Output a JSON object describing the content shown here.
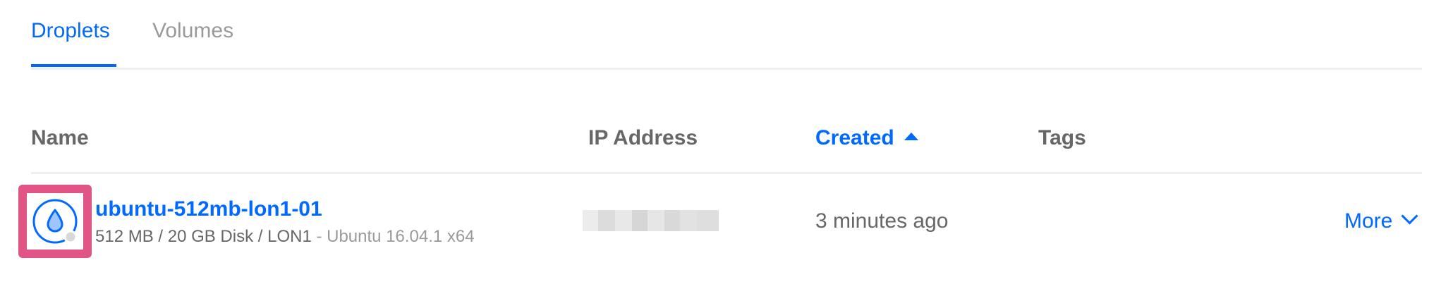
{
  "tabs": {
    "droplets": "Droplets",
    "volumes": "Volumes"
  },
  "table": {
    "headers": {
      "name": "Name",
      "ip_address": "IP Address",
      "created": "Created",
      "tags": "Tags"
    },
    "rows": [
      {
        "name": "ubuntu-512mb-lon1-01",
        "specs": "512 MB / 20 GB Disk / LON1",
        "os": " - Ubuntu 16.04.1 x64",
        "created": "3 minutes ago",
        "more_label": "More"
      }
    ]
  },
  "colors": {
    "accent": "#0069ff",
    "highlight": "#e05486",
    "text": "#676767",
    "muted": "#9a9a9a"
  },
  "icons": {
    "droplet": "droplet-icon",
    "sort": "sort-ascending-icon",
    "more": "chevron-down-icon"
  }
}
